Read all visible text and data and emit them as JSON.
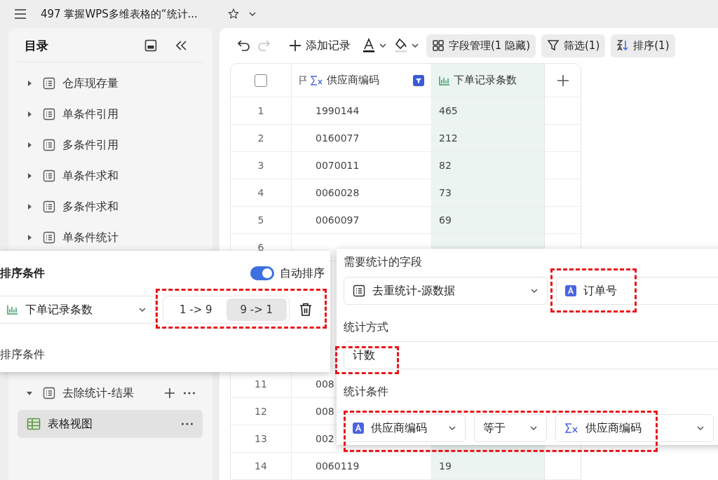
{
  "window": {
    "title": "497 掌握WPS多维表格的“统计...",
    "starred": false
  },
  "sidebar": {
    "title": "目录",
    "items": [
      {
        "label": "仓库现存量",
        "expanded": false,
        "selected": false
      },
      {
        "label": "单条件引用",
        "expanded": false,
        "selected": false
      },
      {
        "label": "多条件引用",
        "expanded": false,
        "selected": false
      },
      {
        "label": "单条件求和",
        "expanded": false,
        "selected": false
      },
      {
        "label": "多条件求和",
        "expanded": false,
        "selected": false
      },
      {
        "label": "单条件统计",
        "expanded": false,
        "selected": false
      }
    ],
    "lower_items": [
      {
        "label": "去除统计-结果",
        "expanded": true,
        "selected": false,
        "children": [
          {
            "label": "表格视图",
            "selected": true
          }
        ]
      }
    ]
  },
  "toolbar": {
    "add_record": "添加记录",
    "buttons": [
      {
        "kind": "fields",
        "label": "字段管理(1 隐藏)"
      },
      {
        "kind": "filter",
        "label": "筛选(1)"
      },
      {
        "kind": "sort",
        "label": "排序(1)"
      }
    ]
  },
  "table": {
    "all_checked": false,
    "columns": [
      {
        "label": "供应商编码",
        "kind": "formula",
        "filtered": true
      },
      {
        "label": "下单记录条数",
        "kind": "stat",
        "filtered": false
      }
    ],
    "rows": [
      {
        "seq": "1",
        "code": "1990144",
        "count": "465"
      },
      {
        "seq": "2",
        "code": "0160077",
        "count": "212"
      },
      {
        "seq": "3",
        "code": "0070011",
        "count": "82"
      },
      {
        "seq": "4",
        "code": "0060028",
        "count": "73"
      },
      {
        "seq": "5",
        "code": "0060097",
        "count": "69"
      },
      {
        "seq": "6"
      },
      {
        "seq": "11",
        "code": "008"
      },
      {
        "seq": "12",
        "code": "008"
      },
      {
        "seq": "13",
        "code": "002"
      },
      {
        "seq": "14",
        "code": "0060119",
        "count": "19"
      }
    ]
  },
  "sort_popup": {
    "title": "排序条件",
    "auto_sort": {
      "label": "自动排序",
      "on": true
    },
    "field": "下单记录条数",
    "orders": [
      {
        "label": "1 -> 9",
        "selected": false
      },
      {
        "label": "9 -> 1",
        "selected": true
      }
    ],
    "add_label": "排序条件"
  },
  "stat_popup": {
    "field_label": "需要统计的字段",
    "table_select": "去重统计-源数据",
    "field_select": "订单号",
    "method_label": "统计方式",
    "method": "计数",
    "condition_label": "统计条件",
    "condition": {
      "field": "供应商编码",
      "operator": "等于",
      "value": "供应商编码"
    }
  }
}
